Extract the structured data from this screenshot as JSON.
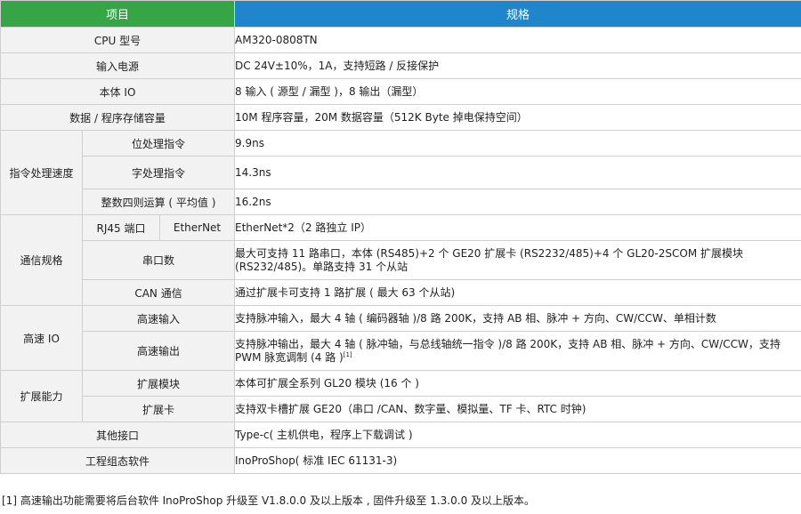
{
  "header": {
    "item": "项目",
    "spec": "规格"
  },
  "rows": {
    "cpu": {
      "label": "CPU 型号",
      "value": "AM320-0808TN"
    },
    "power": {
      "label": "输入电源",
      "value": "DC 24V±10%，1A，支持短路 / 反接保护"
    },
    "io": {
      "label": "本体 IO",
      "value": "8 输入 ( 源型 / 漏型 )，8 输出（漏型）"
    },
    "storage": {
      "label": "数据 / 程序存储容量",
      "value": "10M 程序容量，20M 数据容量（512K Byte 掉电保持空间）"
    },
    "speed": {
      "label": "指令处理速度",
      "bit": {
        "label": "位处理指令",
        "value": "9.9ns"
      },
      "word": {
        "label": "字处理指令",
        "value": "14.3ns"
      },
      "arith": {
        "label": "整数四则运算 ( 平均值 )",
        "value": "16.2ns"
      }
    },
    "comm": {
      "label": "通信规格",
      "rj45": {
        "label": "RJ45 端口",
        "sub": "EtherNet",
        "value": "EtherNet*2（2 路独立 IP）"
      },
      "serial": {
        "label": "串口数",
        "value": "最大可支持 11 路串口，本体 (RS485)+2 个 GE20 扩展卡 (RS2232/485)+4 个 GL20-2SCOM 扩展模块 (RS232/485)。单路支持 31 个从站"
      },
      "can": {
        "label": "CAN 通信",
        "value": "通过扩展卡可支持 1 路扩展 ( 最大 63 个从站)"
      }
    },
    "hsio": {
      "label": "高速 IO",
      "input": {
        "label": "高速输入",
        "value": "支持脉冲输入，最大 4 轴 ( 编码器轴 )/8 路 200K，支持 AB 相、脉冲 + 方向、CW/CCW、单相计数"
      },
      "output": {
        "label": "高速输出",
        "value": "支持脉冲输出，最大 4 轴 ( 脉冲轴，与总线轴统一指令 )/8 路 200K，支持 AB 相、脉冲 + 方向、CW/CCW，支持 PWM 脉宽调制 (4 路 )",
        "sup": "[1]"
      }
    },
    "expand": {
      "label": "扩展能力",
      "module": {
        "label": "扩展模块",
        "value": "本体可扩展全系列 GL20 模块 (16 个 )"
      },
      "card": {
        "label": "扩展卡",
        "value": "支持双卡槽扩展 GE20（串口 /CAN、数字量、模拟量、TF 卡、RTC 时钟)"
      }
    },
    "ports": {
      "label": "其他接口",
      "value": "Type-c( 主机供电，程序上下载调试 )"
    },
    "software": {
      "label": "工程组态软件",
      "value": "InoProShop( 标准 IEC 61131-3)"
    }
  },
  "footnote": "[1] 高速输出功能需要将后台软件 InoProShop 升级至 V1.8.0.0 及以上版本 , 固件升级至 1.3.0.0 及以上版本。",
  "colors": {
    "header_item": "#35a546",
    "header_spec": "#1f86cc",
    "label_bg": "#f2f2f2"
  }
}
